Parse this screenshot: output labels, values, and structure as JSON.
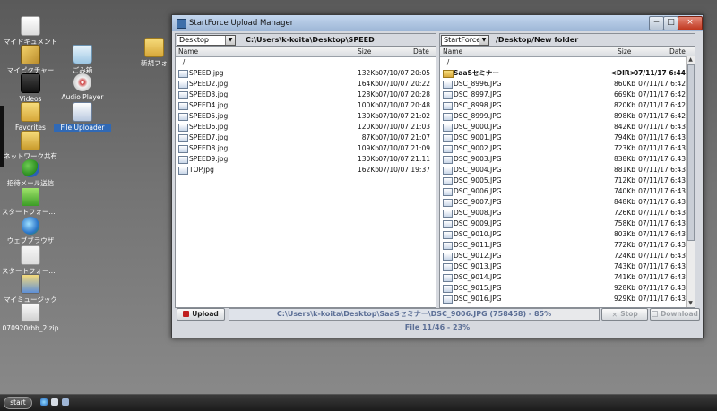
{
  "desktop": {
    "icons": [
      {
        "label": "マイドキュメント",
        "icon": "document-icon"
      },
      {
        "label": "マイピクチャー",
        "icon": "paint-icon"
      },
      {
        "label": "Videos",
        "icon": "film-icon"
      },
      {
        "label": "Favorites",
        "icon": "folder-icon"
      },
      {
        "label": "ネットワーク共有",
        "icon": "network-folder-icon"
      },
      {
        "label": "招待メール送信",
        "icon": "people-icon"
      },
      {
        "label": "スタートフォース ...",
        "icon": "star-icon"
      },
      {
        "label": "ウェブブラウザ",
        "icon": "globe-icon"
      },
      {
        "label": "スタートフォース ...",
        "icon": "notepad-icon"
      },
      {
        "label": "マイミュージック",
        "icon": "music-icon"
      },
      {
        "label": "070920rbb_2.zip",
        "icon": "zip-icon"
      },
      {
        "label": "ごみ箱",
        "icon": "recycle-bin-icon"
      },
      {
        "label": "Audio Player",
        "icon": "cd-icon"
      },
      {
        "label": "File Uploader",
        "icon": "uploader-icon"
      },
      {
        "label": "新規フォ",
        "icon": "folder-icon"
      }
    ]
  },
  "window": {
    "title": "StartForce Upload Manager",
    "controls": {
      "minimize": "−",
      "maximize": "□",
      "close": "×"
    }
  },
  "left_pane": {
    "combo": "Desktop",
    "path": "C:\\Users\\k-koita\\Desktop\\SPEED",
    "columns": {
      "name": "Name",
      "size": "Size",
      "date": "Date"
    },
    "parent": "../",
    "files": [
      {
        "name": "SPEED.jpg",
        "size": "132Kb",
        "date": "07/10/07 20:05"
      },
      {
        "name": "SPEED2.jpg",
        "size": "164Kb",
        "date": "07/10/07 20:22"
      },
      {
        "name": "SPEED3.jpg",
        "size": "128Kb",
        "date": "07/10/07 20:28"
      },
      {
        "name": "SPEED4.jpg",
        "size": "100Kb",
        "date": "07/10/07 20:48"
      },
      {
        "name": "SPEED5.jpg",
        "size": "130Kb",
        "date": "07/10/07 21:02"
      },
      {
        "name": "SPEED6.jpg",
        "size": "120Kb",
        "date": "07/10/07 21:03"
      },
      {
        "name": "SPEED7.jpg",
        "size": "87Kb",
        "date": "07/10/07 21:07"
      },
      {
        "name": "SPEED8.jpg",
        "size": "109Kb",
        "date": "07/10/07 21:09"
      },
      {
        "name": "SPEED9.jpg",
        "size": "130Kb",
        "date": "07/10/07 21:11"
      },
      {
        "name": "TOP.jpg",
        "size": "162Kb",
        "date": "07/10/07 19:37"
      }
    ]
  },
  "right_pane": {
    "combo": "StartForce",
    "path": "/Desktop/New folder",
    "columns": {
      "name": "Name",
      "size": "Size",
      "date": "Date"
    },
    "parent": "../",
    "folder": {
      "name": "SaaSセミナー",
      "size": "<DIR>",
      "date": "07/11/17 6:44"
    },
    "files": [
      {
        "name": "DSC_8996.JPG",
        "size": "860Kb",
        "date": "07/11/17 6:42"
      },
      {
        "name": "DSC_8997.JPG",
        "size": "669Kb",
        "date": "07/11/17 6:42"
      },
      {
        "name": "DSC_8998.JPG",
        "size": "820Kb",
        "date": "07/11/17 6:42"
      },
      {
        "name": "DSC_8999.JPG",
        "size": "898Kb",
        "date": "07/11/17 6:42"
      },
      {
        "name": "DSC_9000.JPG",
        "size": "842Kb",
        "date": "07/11/17 6:43"
      },
      {
        "name": "DSC_9001.JPG",
        "size": "794Kb",
        "date": "07/11/17 6:43"
      },
      {
        "name": "DSC_9002.JPG",
        "size": "723Kb",
        "date": "07/11/17 6:43"
      },
      {
        "name": "DSC_9003.JPG",
        "size": "838Kb",
        "date": "07/11/17 6:43"
      },
      {
        "name": "DSC_9004.JPG",
        "size": "881Kb",
        "date": "07/11/17 6:43"
      },
      {
        "name": "DSC_9005.JPG",
        "size": "712Kb",
        "date": "07/11/17 6:43"
      },
      {
        "name": "DSC_9006.JPG",
        "size": "740Kb",
        "date": "07/11/17 6:43"
      },
      {
        "name": "DSC_9007.JPG",
        "size": "848Kb",
        "date": "07/11/17 6:43"
      },
      {
        "name": "DSC_9008.JPG",
        "size": "726Kb",
        "date": "07/11/17 6:43"
      },
      {
        "name": "DSC_9009.JPG",
        "size": "758Kb",
        "date": "07/11/17 6:43"
      },
      {
        "name": "DSC_9010.JPG",
        "size": "803Kb",
        "date": "07/11/17 6:43"
      },
      {
        "name": "DSC_9011.JPG",
        "size": "772Kb",
        "date": "07/11/17 6:43"
      },
      {
        "name": "DSC_9012.JPG",
        "size": "724Kb",
        "date": "07/11/17 6:43"
      },
      {
        "name": "DSC_9013.JPG",
        "size": "743Kb",
        "date": "07/11/17 6:43"
      },
      {
        "name": "DSC_9014.JPG",
        "size": "741Kb",
        "date": "07/11/17 6:43"
      },
      {
        "name": "DSC_9015.JPG",
        "size": "928Kb",
        "date": "07/11/17 6:43"
      },
      {
        "name": "DSC_9016.JPG",
        "size": "929Kb",
        "date": "07/11/17 6:43"
      }
    ]
  },
  "transfer": {
    "upload_label": "Upload",
    "progress_text": "C:\\Users\\k-koita\\Desktop\\SaaSセミナー\\DSC_9006.JPG (758458)  -  85%",
    "progress_fraction": 0.85,
    "stop_label": "Stop",
    "download_label": "Download",
    "status": "File 11/46 - 23%"
  },
  "taskbar": {
    "start_label": "start"
  }
}
